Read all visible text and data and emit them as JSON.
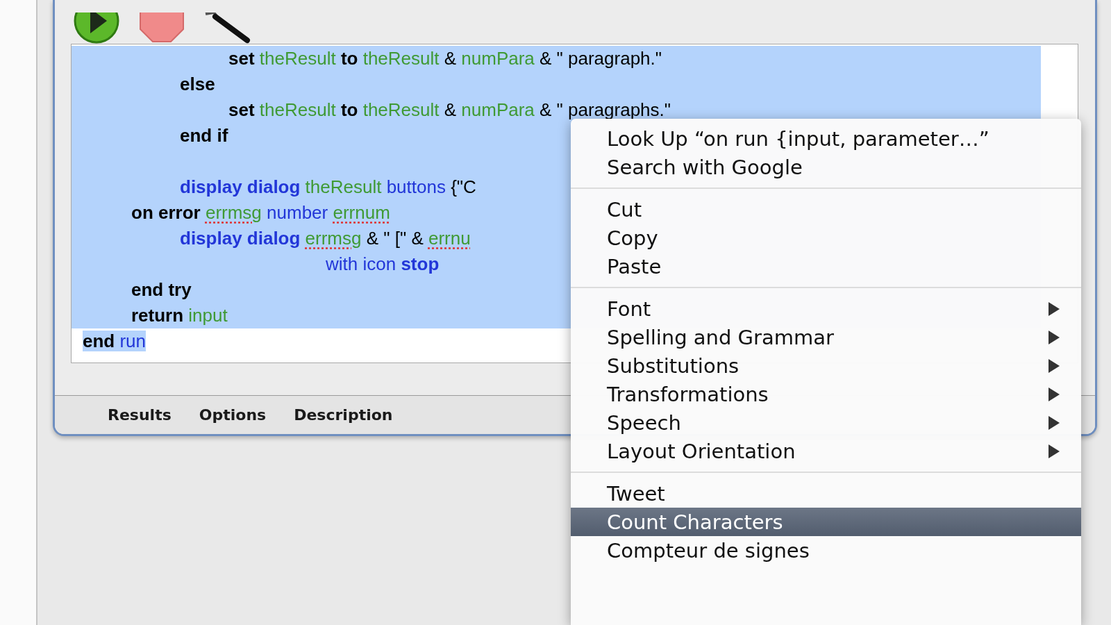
{
  "toolbar": [
    {
      "kind": "run"
    },
    {
      "kind": "stop"
    },
    {
      "kind": "compile"
    }
  ],
  "editor": {
    "lines": [
      {
        "selected": true,
        "tokens": [
          {
            "t": "\t\t\tset ",
            "kind": "keyword"
          },
          {
            "t": "theResult",
            "kind": "variable"
          },
          {
            "t": " to ",
            "kind": "keyword"
          },
          {
            "t": "theResult",
            "kind": "variable"
          },
          {
            "t": " & ",
            "kind": "plain"
          },
          {
            "t": "numPara",
            "kind": "variable"
          },
          {
            "t": " & \" paragraph.\"",
            "kind": "plain"
          }
        ]
      },
      {
        "selected": true,
        "tokens": [
          {
            "t": "\t\telse",
            "kind": "keyword"
          }
        ]
      },
      {
        "selected": true,
        "tokens": [
          {
            "t": "\t\t\tset ",
            "kind": "keyword"
          },
          {
            "t": "theResult",
            "kind": "variable"
          },
          {
            "t": " to ",
            "kind": "keyword"
          },
          {
            "t": "theResult",
            "kind": "variable"
          },
          {
            "t": " & ",
            "kind": "plain"
          },
          {
            "t": "numPara",
            "kind": "variable"
          },
          {
            "t": " & \" paragraphs.\"",
            "kind": "plain"
          }
        ]
      },
      {
        "selected": true,
        "tokens": [
          {
            "t": "\t\tend if",
            "kind": "keyword"
          }
        ]
      },
      {
        "selected": true
      },
      {
        "selected": true,
        "tokens": [
          {
            "t": "\t\tdisplay dialog ",
            "kind": "command"
          },
          {
            "t": "theResult",
            "kind": "variable"
          },
          {
            "t": " buttons ",
            "kind": "term"
          },
          {
            "t": "{\"C",
            "kind": "plain"
          }
        ]
      },
      {
        "selected": true,
        "tokens": [
          {
            "t": "\ton error ",
            "kind": "keyword"
          },
          {
            "t": "errmsg",
            "kind": "variable",
            "underline": true
          },
          {
            "t": " number ",
            "kind": "term"
          },
          {
            "t": "errnum",
            "kind": "variable",
            "underline": true
          }
        ]
      },
      {
        "selected": true,
        "tokens": [
          {
            "t": "\t\tdisplay dialog ",
            "kind": "command"
          },
          {
            "t": "errmsg",
            "kind": "variable",
            "underline": true
          },
          {
            "t": " & \" [\" & ",
            "kind": "plain"
          },
          {
            "t": "errnu",
            "kind": "variable",
            "underline": true
          }
        ]
      },
      {
        "selected": true,
        "tokens": [
          {
            "t": "\t\t\t\t\twith icon ",
            "kind": "term"
          },
          {
            "t": "stop",
            "kind": "command"
          }
        ]
      },
      {
        "selected": true,
        "tokens": [
          {
            "t": "\tend try",
            "kind": "keyword"
          }
        ]
      },
      {
        "selected": true,
        "tokens": [
          {
            "t": "\treturn ",
            "kind": "keyword"
          },
          {
            "t": "input",
            "kind": "variable"
          }
        ]
      },
      {
        "selected": false,
        "tokens": [
          {
            "t": "end ",
            "kind": "keyword",
            "selected": true
          },
          {
            "t": "run",
            "kind": "term",
            "selected": true
          }
        ]
      }
    ]
  },
  "bottom_tabs": [
    {
      "label": "Results"
    },
    {
      "label": "Options"
    },
    {
      "label": "Description"
    }
  ],
  "context_menu": [
    {
      "kind": "item",
      "label": "Look Up “on run {input, parameter…”",
      "selected": false
    },
    {
      "kind": "item",
      "label": "Search with Google",
      "selected": false
    },
    {
      "kind": "separator"
    },
    {
      "kind": "item",
      "label": "Cut",
      "selected": false
    },
    {
      "kind": "item",
      "label": "Copy",
      "selected": false
    },
    {
      "kind": "item",
      "label": "Paste",
      "selected": false
    },
    {
      "kind": "separator"
    },
    {
      "kind": "submenu",
      "label": "Font",
      "selected": false
    },
    {
      "kind": "submenu",
      "label": "Spelling and Grammar",
      "selected": false
    },
    {
      "kind": "submenu",
      "label": "Substitutions",
      "selected": false
    },
    {
      "kind": "submenu",
      "label": "Transformations",
      "selected": false
    },
    {
      "kind": "submenu",
      "label": "Speech",
      "selected": false
    },
    {
      "kind": "submenu",
      "label": "Layout Orientation",
      "selected": false
    },
    {
      "kind": "separator"
    },
    {
      "kind": "item",
      "label": "Tweet",
      "selected": false
    },
    {
      "kind": "item",
      "label": "Count Characters",
      "selected": true
    },
    {
      "kind": "item",
      "label": "Compteur de signes",
      "selected": false
    }
  ]
}
